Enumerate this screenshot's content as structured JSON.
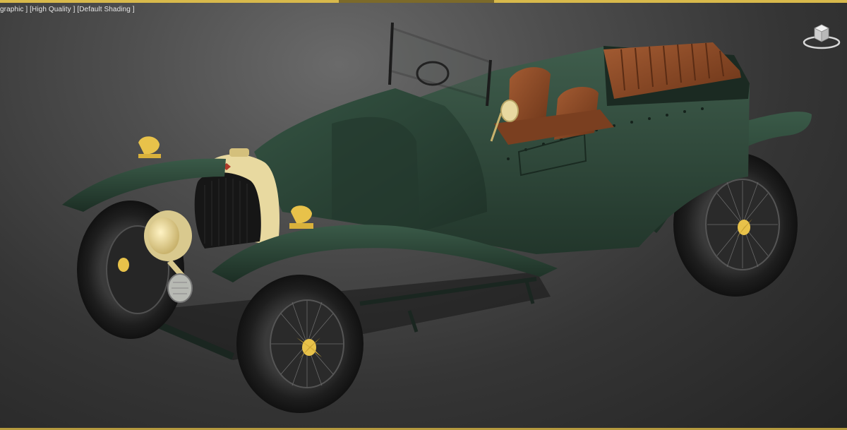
{
  "viewport": {
    "labels": {
      "view": "graphic ]",
      "quality": "[High Quality ]",
      "shading": "[Default Shading ]"
    }
  },
  "icons": {
    "viewcube": "viewcube-icon"
  },
  "colors": {
    "viewport_border": "#d8b94b",
    "car_body": "#2b4336",
    "car_body_highlight": "#3f5d4c",
    "leather": "#8a4a2a",
    "brass_cream": "#e8d9a0",
    "lamp_yellow": "#e8c24a",
    "tyre": "#1e1e1e"
  }
}
